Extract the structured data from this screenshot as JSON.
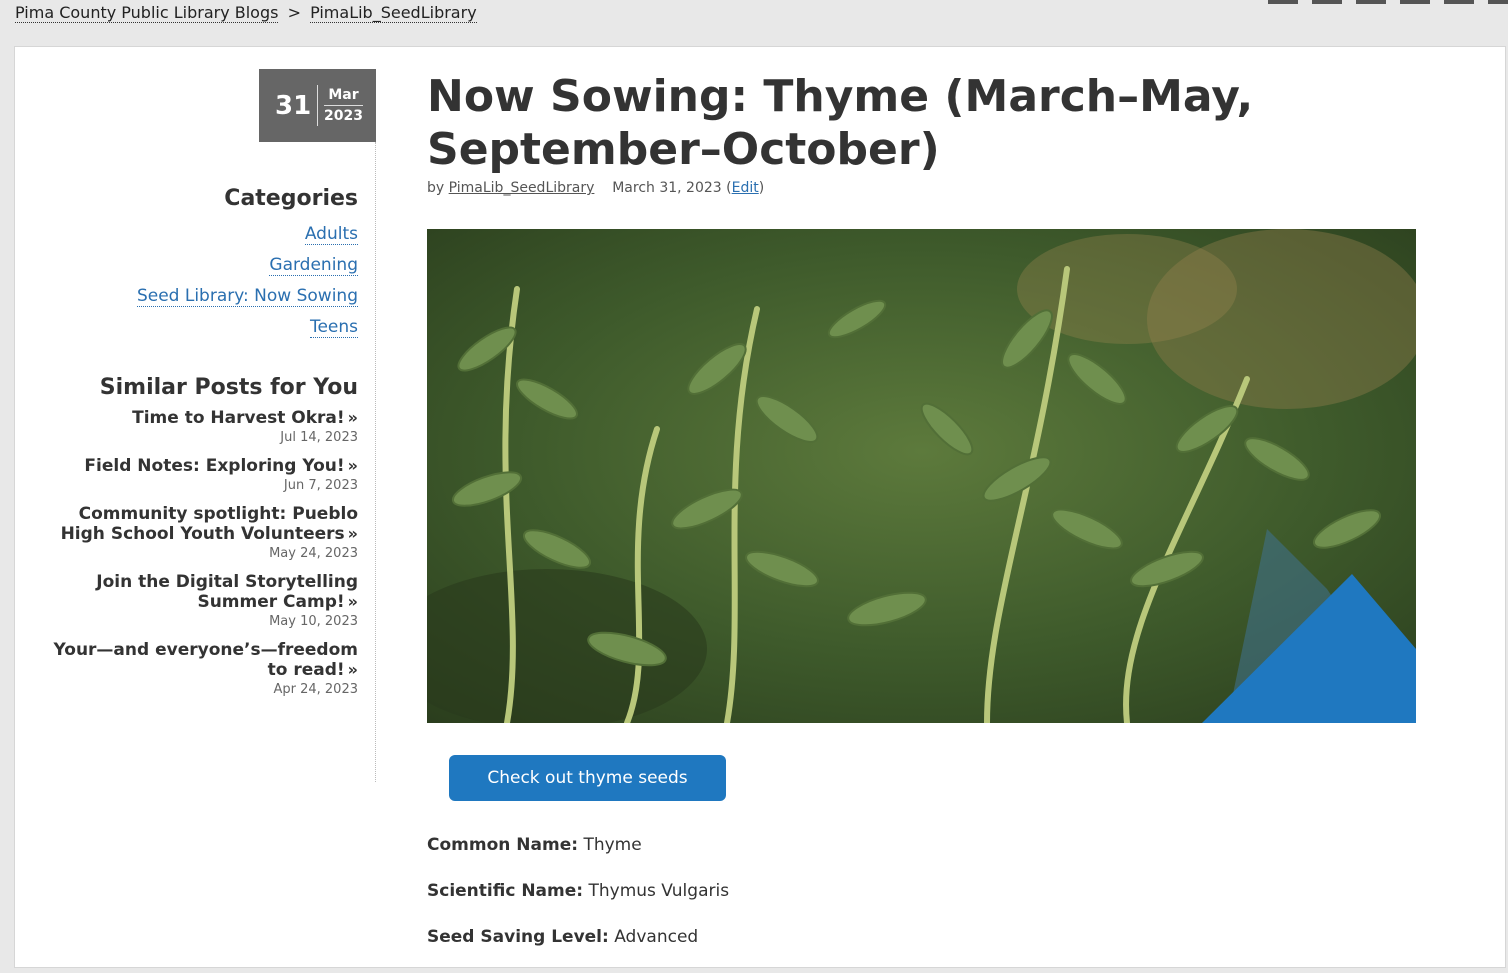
{
  "breadcrumb": {
    "root": "Pima County Public Library Blogs",
    "separator": ">",
    "current": "PimaLib_SeedLibrary"
  },
  "date": {
    "day": "31",
    "month": "Mar",
    "year": "2023"
  },
  "categories": {
    "heading": "Categories",
    "items": [
      "Adults",
      "Gardening",
      "Seed Library: Now Sowing",
      "Teens"
    ]
  },
  "similar": {
    "heading": "Similar Posts for You",
    "posts": [
      {
        "title": "Time to Harvest Okra!",
        "date": "Jul 14, 2023"
      },
      {
        "title": "Field Notes: Exploring You!",
        "date": "Jun 7, 2023"
      },
      {
        "title": "Community spotlight: Pueblo High School Youth Volunteers",
        "date": "May 24, 2023"
      },
      {
        "title": "Join the Digital Storytelling Summer Camp!",
        "date": "May 10, 2023"
      },
      {
        "title": "Your—and everyone’s—freedom to read!",
        "date": "Apr 24, 2023"
      }
    ],
    "arrow": "»"
  },
  "post": {
    "title": "Now Sowing: Thyme (March–May, September–October)",
    "by": "by",
    "author": "PimaLib_SeedLibrary",
    "date": "March 31, 2023",
    "edit": "Edit",
    "image_alt": "Thyme plant"
  },
  "button": {
    "label": "Check out thyme seeds"
  },
  "facts": [
    {
      "label": "Common Name:",
      "value": "Thyme"
    },
    {
      "label": "Scientific Name:",
      "value": "Thymus Vulgaris"
    },
    {
      "label": "Seed Saving Level:",
      "value": "Advanced"
    }
  ],
  "colors": {
    "accent": "#1f78c0",
    "link": "#2a6fb0",
    "datebox": "#666666"
  }
}
